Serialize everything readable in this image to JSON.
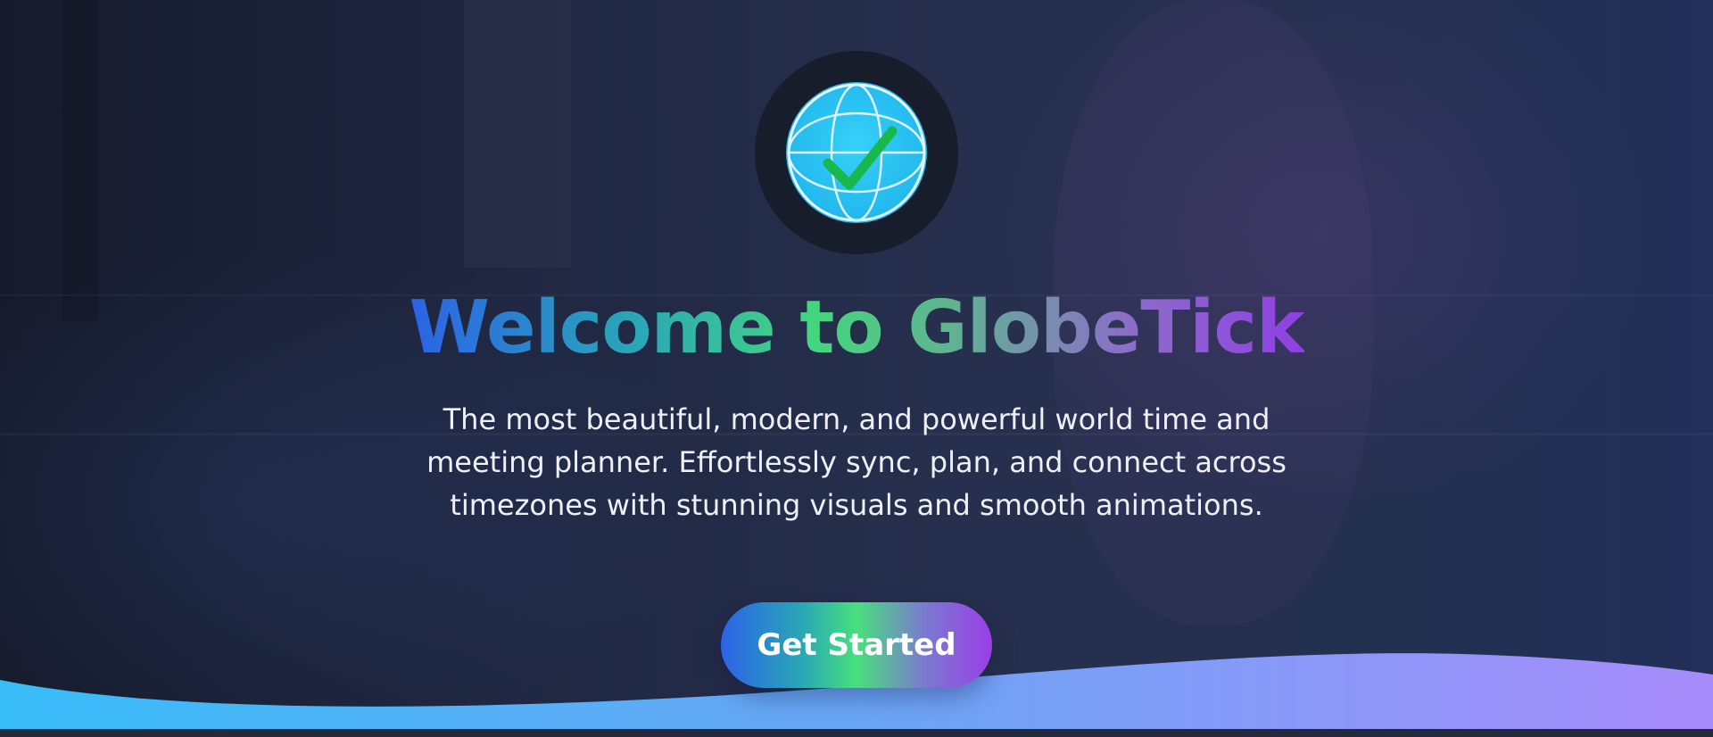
{
  "hero": {
    "title": "Welcome to GlobeTick",
    "subtitle": "The most beautiful, modern, and powerful world time and meeting planner. Effortlessly sync, plan, and connect across timezones with stunning visuals and smooth animations.",
    "cta_label": "Get Started",
    "logo_icon": "globe-check-icon"
  },
  "colors": {
    "gradient_start": "#2c62e6",
    "gradient_mid": "#44d67f",
    "gradient_end": "#8f3fe3",
    "globe_fill": "#2fc7f0",
    "check_color": "#19b84f",
    "wave_start": "#38bdf8",
    "wave_end": "#a78bfa"
  }
}
